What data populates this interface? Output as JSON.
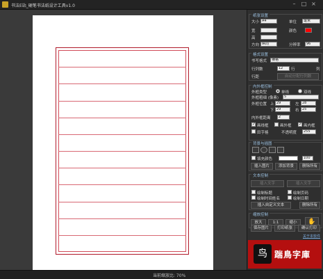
{
  "window": {
    "title": "书法E站_硬笔书法纸设计工具v1.0",
    "min_glyph": "–",
    "max_glyph": "□",
    "close_glyph": "×"
  },
  "paper": {
    "border_color": "#b01a2a",
    "line_color": "#d86873",
    "line_count": 12
  },
  "status": {
    "zoom_text": "当前缩放比: 70%"
  },
  "panel": {
    "paper": {
      "header": "纸张设置",
      "size_label": "大小",
      "size_value": "A4",
      "unit_label": "单位",
      "unit_value": "毫米",
      "width_label": "宽",
      "height_label": "高",
      "color_label": "颜色",
      "color_value": "#ff0000",
      "direction_label": "方向",
      "direction_value": "纵向",
      "dpi_label": "分辨率",
      "dpi_value": "96"
    },
    "format": {
      "header": "格式设置",
      "style_label": "书写格式",
      "style_value": "横格",
      "rows_label": "行列数",
      "rows_value": "12",
      "rows_unit": "行",
      "cols_unit": "列",
      "spacing_label": "行距",
      "margin_label": "外框",
      "auto_button": "自动分配行列数"
    },
    "frame": {
      "header": "内外框控制",
      "type_label": "外框类型",
      "single": "单线",
      "double": "双线",
      "thickness_label": "外框粗细 (像素)",
      "thickness_value": "5",
      "pos_label": "外框位置",
      "top_label": "上",
      "top_value": "29",
      "left_label": "左",
      "left_value": "28",
      "bottom_label": "下",
      "bottom_value": "29",
      "right_label": "右",
      "right_value": "25",
      "inner_label": "内外框距离",
      "inner_value": "2",
      "opt_a": "画线框",
      "opt_b": "画外框",
      "opt_c": "画内框",
      "opt_d": "田字格",
      "opacity_label": "不透明度",
      "opacity_value": "255"
    },
    "background": {
      "header": "背景与插图",
      "fill_label": "填充颜色",
      "fill_value": "100",
      "insert_button": "插入图片",
      "add_bg_button": "添加背景",
      "delete_button": "删除所有"
    },
    "text": {
      "header": "文本控制",
      "font_button": "插入文字",
      "font_button2": "插入文字",
      "opt_a": "绘制标题",
      "opt_b": "绘制页码",
      "opt_c": "绘制时间姓名",
      "opt_d": "绘制日期",
      "custom_button": "插入自定义文本",
      "delete_button": "删除所有"
    },
    "zoom": {
      "header": "缩放控制",
      "zoom_in": "放大",
      "zoom_reset": "1:1",
      "zoom_out": "缩小"
    },
    "actions": {
      "save_button": "保存图片",
      "print_button": "打印纸张",
      "exit_button": "确认打印",
      "about_link": "关于本软件"
    },
    "logo": {
      "mark": "鸟",
      "text": "踹鳥字庫"
    }
  }
}
